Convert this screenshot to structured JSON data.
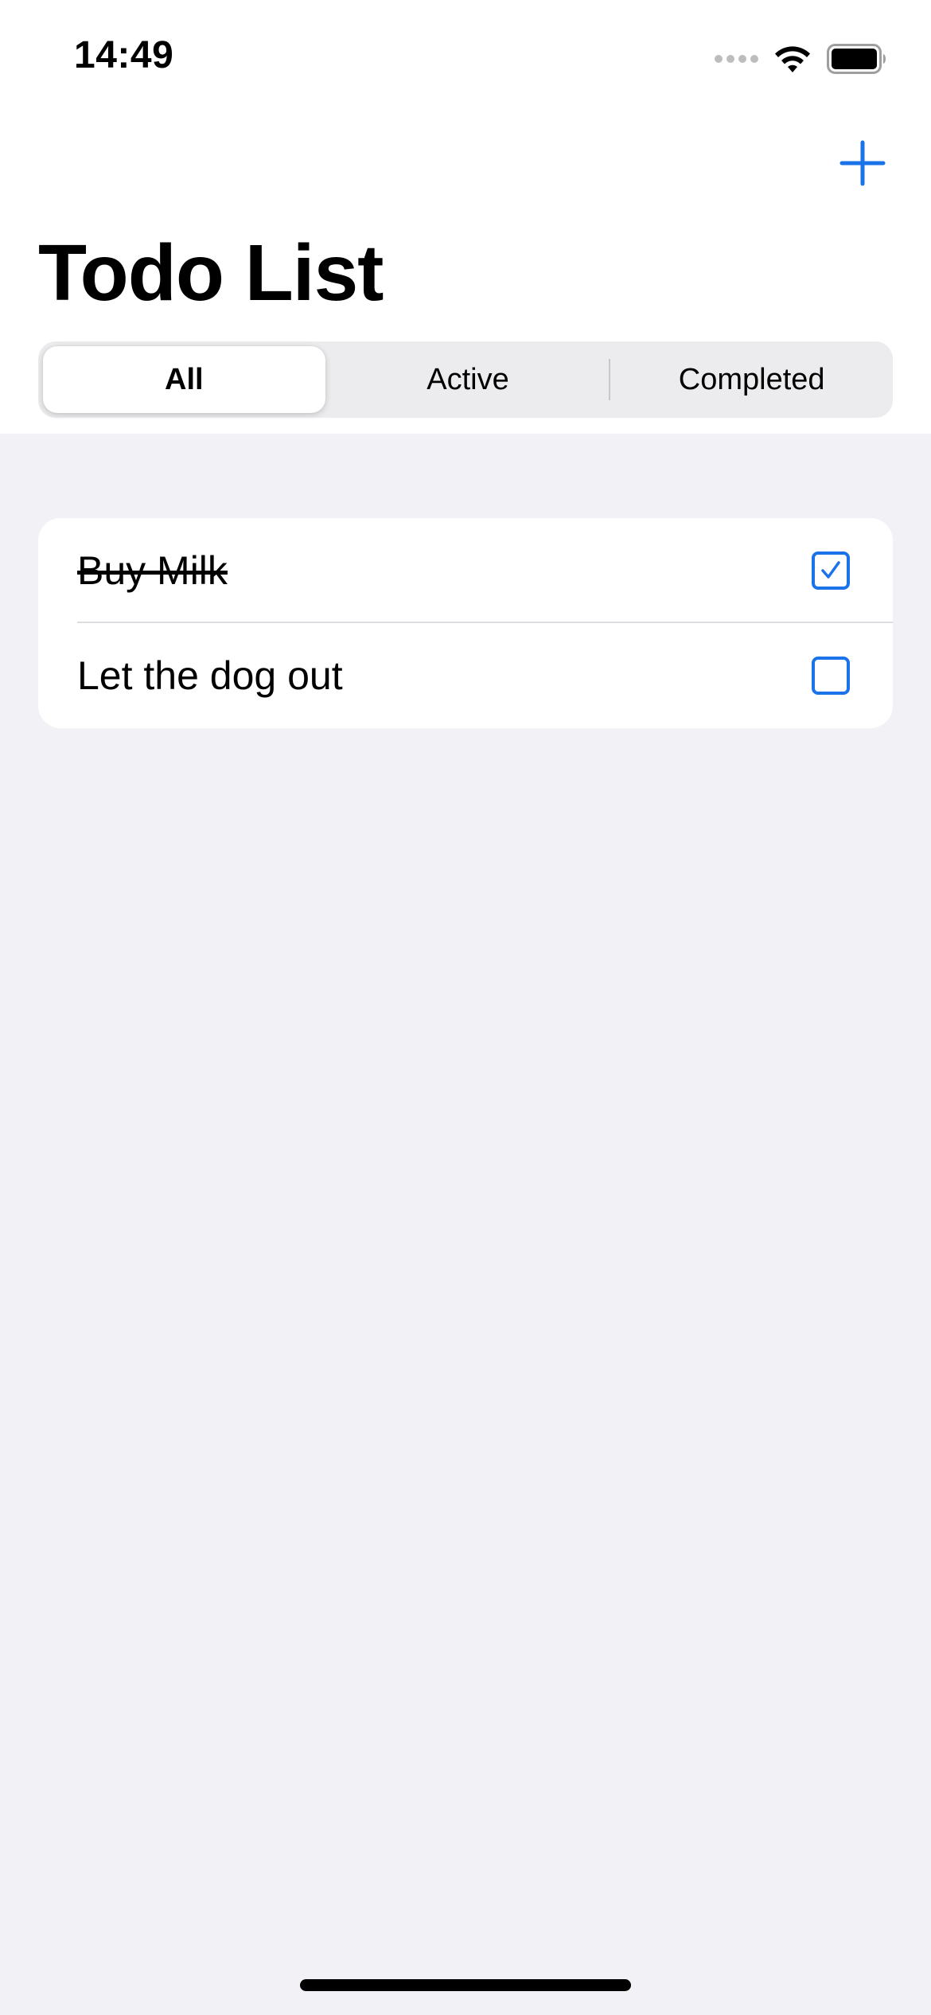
{
  "status_bar": {
    "time": "14:49"
  },
  "nav": {
    "add_icon": "plus-icon",
    "title": "Todo List"
  },
  "filter": {
    "segments": [
      "All",
      "Active",
      "Completed"
    ],
    "selected": "All"
  },
  "todos": [
    {
      "text": "Buy Milk",
      "completed": true
    },
    {
      "text": "Let the dog out",
      "completed": false
    }
  ],
  "colors": {
    "accent": "#1A73E8",
    "background": "#F1F1F6",
    "card": "#FFFFFF",
    "segment_bg": "#ECECEE"
  }
}
